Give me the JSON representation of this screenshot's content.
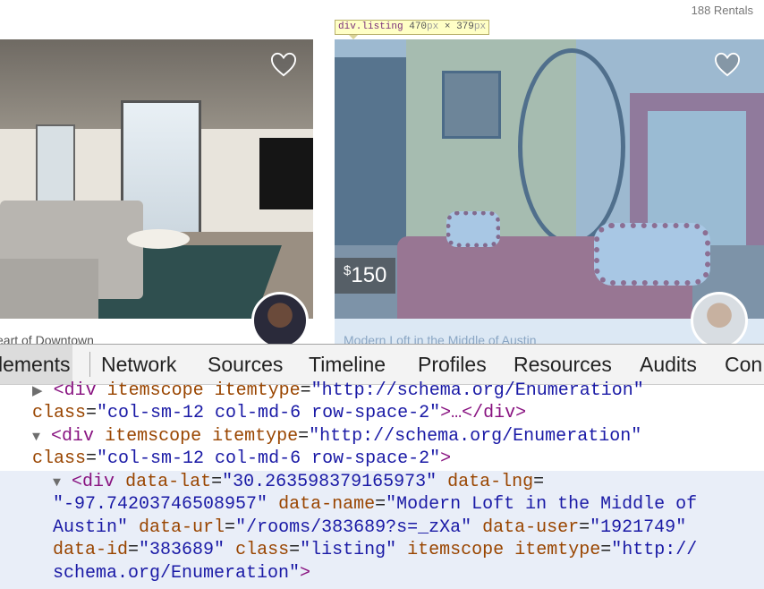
{
  "page": {
    "rentals_count": "188 Rentals",
    "tooltip": {
      "selector": "div.listing",
      "width": "470",
      "height": "379",
      "unit": "px",
      "times": "×"
    }
  },
  "listings": [
    {
      "title": "eart of Downtown",
      "avatar": "host-avatar-couple"
    },
    {
      "title": "Modern Loft in the Middle of Austin",
      "price": "150",
      "currency": "$",
      "avatar": "host-avatar-couple"
    }
  ],
  "devtools": {
    "tabs": [
      "lements",
      "Network",
      "Sources",
      "Timeline",
      "Profiles",
      "Resources",
      "Audits",
      "Con"
    ],
    "active_tab": "lements",
    "dom": {
      "node1": {
        "triangle": "▶",
        "tag_open": "<div",
        "attr1": "itemscope",
        "attr2": "itemtype",
        "attr2_val": "\"http://schema.org/Enumeration\"",
        "attr3": "class",
        "attr3_val": "\"col-sm-12 col-md-6 row-space-2\"",
        "close": ">…</div>"
      },
      "node2": {
        "triangle": "▼",
        "tag_open": "<div",
        "attr1": "itemscope",
        "attr2": "itemtype",
        "attr2_val": "\"http://schema.org/Enumeration\"",
        "attr3": "class",
        "attr3_val": "\"col-sm-12 col-md-6 row-space-2\"",
        "close": ">"
      },
      "node3": {
        "triangle": "▼",
        "tag_open": "<div",
        "lat_attr": "data-lat",
        "lat_val": "\"30.263598379165973\"",
        "lng_attr": "data-lng",
        "lng_val": "\"-97.7420374650895 7\"",
        "name_attr": "data-name",
        "name_val_1": "\"Modern Loft in the Middle of",
        "name_val_2": "Austin\"",
        "url_attr": "data-url",
        "url_val": "\"/rooms/383689?s=_zXa\"",
        "user_attr": "data-user",
        "user_val": "\"1921749\"",
        "id_attr": "data-id",
        "id_val": "\"383689\"",
        "class_attr": "class",
        "class_val": "\"listing\"",
        "itemscope": "itemscope",
        "itemtype_attr": "itemtype",
        "itemtype_val_1": "\"http://",
        "itemtype_val_2": "schema.org/Enumeration\"",
        "close": ">"
      }
    }
  },
  "colors": {
    "selection": "#e9eef8",
    "overlay": "#6fa8dc",
    "tag": "#881280",
    "attr": "#994500",
    "value": "#1a1aa6"
  }
}
